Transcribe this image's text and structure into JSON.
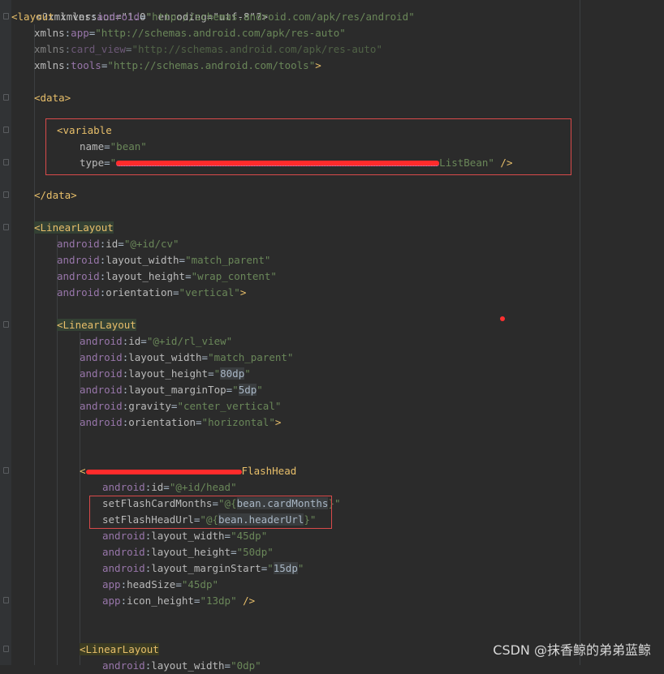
{
  "line0": {
    "text": "<?xml version=\"1.0\" encoding=\"utf-8\"?>"
  },
  "line1": {
    "tag": "<layout",
    "ns": "xmlns",
    "sep": ":",
    "attr": "android",
    "eq": "=",
    "val": "\"http://schemas.android.com/apk/res/android\""
  },
  "line2": {
    "ns": "xmlns",
    "sep": ":",
    "attr": "app",
    "eq": "=",
    "val": "\"http://schemas.android.com/apk/res-auto\""
  },
  "line3": {
    "ns": "xmlns",
    "sep": ":",
    "attr": "card_view",
    "eq": "=",
    "val": "\"http://schemas.android.com/apk/res-auto\""
  },
  "line4": {
    "ns": "xmlns",
    "sep": ":",
    "attr": "tools",
    "eq": "=",
    "val": "\"http://schemas.android.com/tools\"",
    "end": ">"
  },
  "line6": {
    "tag": "<data>"
  },
  "line8": {
    "tag": "<variable"
  },
  "line9": {
    "attr": "name",
    "eq": "=",
    "val": "\"bean\""
  },
  "line10": {
    "attr": "type",
    "eq": "=",
    "valpre": "\"",
    "valpost": "ListBean\"",
    "end": " />"
  },
  "line12": {
    "tag": "</data>"
  },
  "line14": {
    "tag": "<LinearLayout"
  },
  "line15": {
    "ns": "android",
    "attr": "id",
    "val": "\"@+id/cv\""
  },
  "line16": {
    "ns": "android",
    "attr": "layout_width",
    "val": "\"match_parent\""
  },
  "line17": {
    "ns": "android",
    "attr": "layout_height",
    "val": "\"wrap_content\""
  },
  "line18": {
    "ns": "android",
    "attr": "orientation",
    "val": "\"vertical\"",
    "end": ">"
  },
  "line20": {
    "tag": "<LinearLayout"
  },
  "line21": {
    "ns": "android",
    "attr": "id",
    "val": "\"@+id/rl_view\""
  },
  "line22": {
    "ns": "android",
    "attr": "layout_width",
    "val": "\"match_parent\""
  },
  "line23": {
    "ns": "android",
    "attr": "layout_height",
    "valq": "\"",
    "valh": "80dp",
    "valq2": "\""
  },
  "line24": {
    "ns": "android",
    "attr": "layout_marginTop",
    "valq": "\"",
    "valh": "5dp",
    "valq2": "\""
  },
  "line25": {
    "ns": "android",
    "attr": "gravity",
    "val": "\"center_vertical\""
  },
  "line26": {
    "ns": "android",
    "attr": "orientation",
    "val": "\"horizontal\"",
    "end": ">"
  },
  "line29": {
    "tag_open": "<",
    "tag_name": "FlashHead"
  },
  "line30": {
    "ns": "android",
    "attr": "id",
    "val": "\"@+id/head\""
  },
  "line31": {
    "attr": "setFlashCardMonths",
    "valpre": "\"@{",
    "valh": "bean.cardMonths",
    "valpost": "}\""
  },
  "line32": {
    "attr": "setFlashHeadUrl",
    "valpre": "\"@{",
    "valh": "bean.headerUrl",
    "valpost": "}\""
  },
  "line33": {
    "ns": "android",
    "attr": "layout_width",
    "val": "\"45dp\""
  },
  "line34": {
    "ns": "android",
    "attr": "layout_height",
    "val": "\"50dp\""
  },
  "line35": {
    "ns": "android",
    "attr": "layout_marginStart",
    "valq": "\"",
    "valh": "15dp",
    "valq2": "\""
  },
  "line36": {
    "ns": "app",
    "attr": "headSize",
    "val": "\"45dp\""
  },
  "line37": {
    "ns": "app",
    "attr": "icon_height",
    "val": "\"13dp\"",
    "end": " />"
  },
  "line40": {
    "tag": "<LinearLayout"
  },
  "line41": {
    "ns": "android",
    "attr": "layout_width",
    "val": "\"0dp\""
  },
  "watermark": "CSDN @抹香鲸的弟弟蓝鲸",
  "colors": {
    "background": "#2b2b2b",
    "tag": "#e8bf6a",
    "namespace": "#9876aa",
    "attribute": "#bababa",
    "value": "#6a8759",
    "highlight_box": "#d94a4a",
    "redaction": "#ff2b2b"
  }
}
